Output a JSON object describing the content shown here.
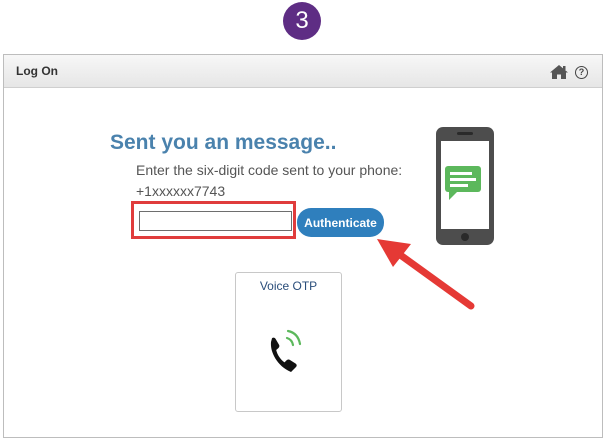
{
  "step_badge": "3",
  "window": {
    "title": "Log On",
    "icons": [
      "home-icon",
      "help-icon"
    ],
    "help_glyph": "?"
  },
  "main": {
    "heading": "Sent you an message..",
    "instructions": "Enter the six-digit code sent to your phone:",
    "phone_number": "+1xxxxxx7743",
    "code_input": {
      "value": "",
      "placeholder": ""
    },
    "authenticate_label": "Authenticate"
  },
  "voice_otp": {
    "label": "Voice OTP",
    "icon": "phone-call-icon"
  },
  "illustration": {
    "icon": "smartphone-message-icon"
  },
  "colors": {
    "badge": "#5e2d84",
    "heading": "#4a82ad",
    "button": "#2f7fbd",
    "highlight": "#e03c3c",
    "message_bubble": "#5cb85c"
  }
}
